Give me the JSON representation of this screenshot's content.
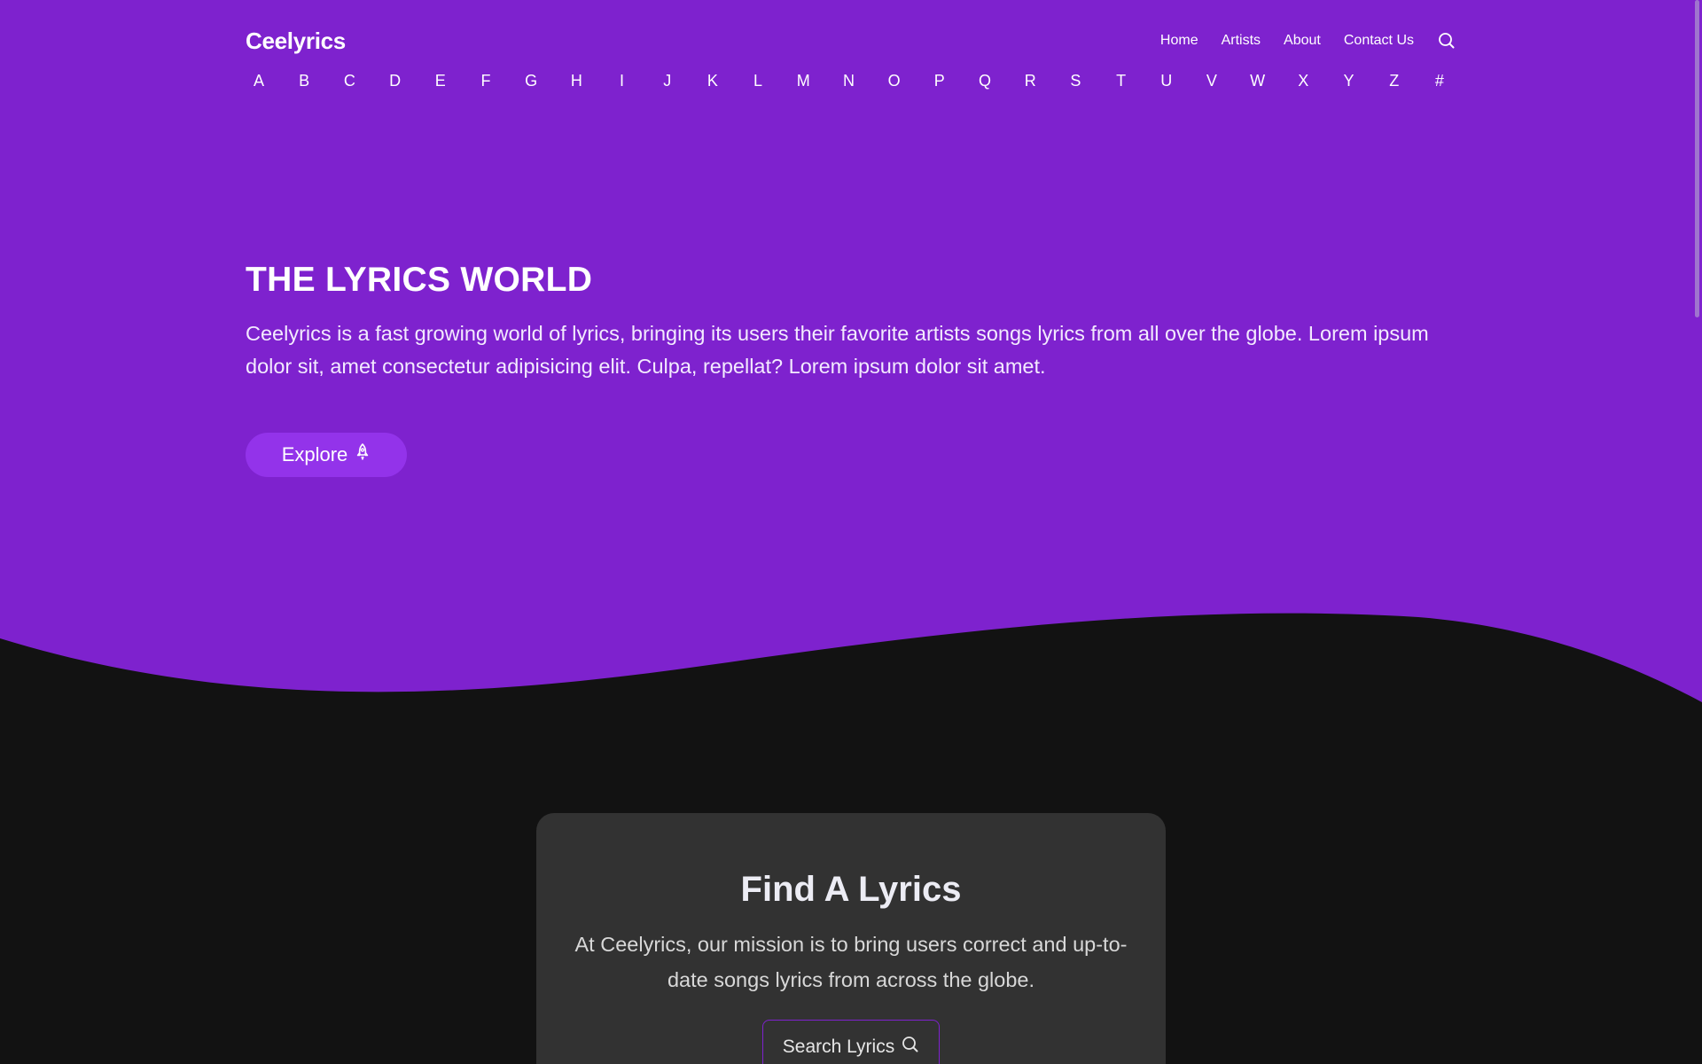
{
  "header": {
    "brand": "Ceelyrics",
    "nav": [
      {
        "label": "Home"
      },
      {
        "label": "Artists"
      },
      {
        "label": "About"
      },
      {
        "label": "Contact Us"
      }
    ],
    "search_icon": "search-icon"
  },
  "alphabet": [
    "A",
    "B",
    "C",
    "D",
    "E",
    "F",
    "G",
    "H",
    "I",
    "J",
    "K",
    "L",
    "M",
    "N",
    "O",
    "P",
    "Q",
    "R",
    "S",
    "T",
    "U",
    "V",
    "W",
    "X",
    "Y",
    "Z",
    "#"
  ],
  "hero": {
    "title": "THE LYRICS WORLD",
    "description": "Ceelyrics is a fast growing world of lyrics, bringing its users their favorite artists songs lyrics from all over the globe. Lorem ipsum dolor sit, amet consectetur adipisicing elit. Culpa, repellat? Lorem ipsum dolor sit amet.",
    "explore_label": "Explore",
    "explore_icon": "rocket-icon"
  },
  "find_card": {
    "title": "Find A Lyrics",
    "description": "At Ceelyrics, our mission is to bring users correct and up-to-date songs lyrics from across the globe.",
    "search_label": "Search Lyrics",
    "search_icon": "search-icon"
  },
  "colors": {
    "primary": "#7e22ce",
    "button": "#9333ea",
    "dark_bg": "#121212",
    "card_bg": "#323232"
  }
}
